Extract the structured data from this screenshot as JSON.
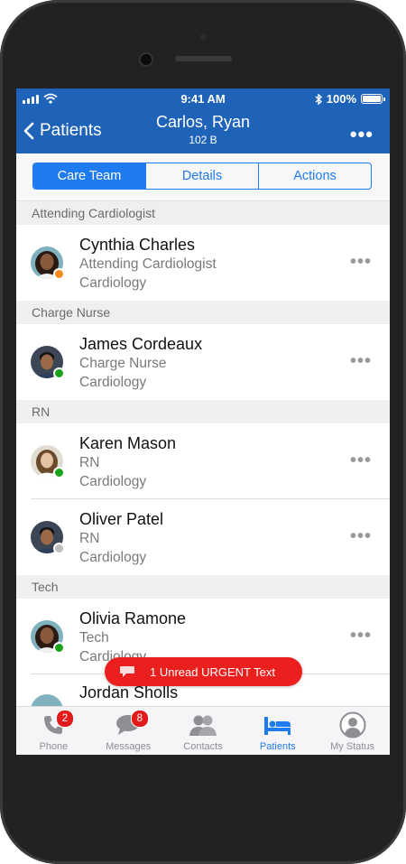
{
  "status_bar": {
    "time": "9:41 AM",
    "battery": "100%"
  },
  "nav": {
    "back_label": "Patients",
    "title": "Carlos, Ryan",
    "subtitle": "102 B",
    "more": "•••"
  },
  "tabs": [
    {
      "label": "Care Team",
      "active": true
    },
    {
      "label": "Details",
      "active": false
    },
    {
      "label": "Actions",
      "active": false
    }
  ],
  "sections": [
    {
      "header": "Attending Cardiologist",
      "members": [
        {
          "name": "Cynthia Charles",
          "role": "Attending Cardiologist",
          "dept": "Cardiology",
          "presence": "away"
        }
      ]
    },
    {
      "header": "Charge Nurse",
      "members": [
        {
          "name": "James Cordeaux",
          "role": "Charge Nurse",
          "dept": "Cardiology",
          "presence": "available"
        }
      ]
    },
    {
      "header": "RN",
      "members": [
        {
          "name": "Karen Mason",
          "role": "RN",
          "dept": "Cardiology",
          "presence": "available"
        },
        {
          "name": "Oliver Patel",
          "role": "RN",
          "dept": "Cardiology",
          "presence": "offline"
        }
      ]
    },
    {
      "header": "Tech",
      "members": [
        {
          "name": "Olivia Ramone",
          "role": "Tech",
          "dept": "Cardiology",
          "presence": "available"
        },
        {
          "name": "Jordan Sholls",
          "role": "",
          "dept": "",
          "presence": ""
        }
      ]
    }
  ],
  "row_more": "•••",
  "urgent_banner": "1 Unread URGENT Text",
  "tab_bar": [
    {
      "label": "Phone",
      "icon": "phone-icon",
      "badge": "2"
    },
    {
      "label": "Messages",
      "icon": "messages-icon",
      "badge": "8"
    },
    {
      "label": "Contacts",
      "icon": "contacts-icon",
      "badge": ""
    },
    {
      "label": "Patients",
      "icon": "patients-icon",
      "badge": "",
      "active": true
    },
    {
      "label": "My Status",
      "icon": "my-status-icon",
      "badge": ""
    }
  ],
  "colors": {
    "nav_blue": "#1f63b8",
    "accent_blue": "#1f7cf0",
    "urgent_red": "#ec1f1f",
    "available": "#1aa31a",
    "away": "#f58a1f",
    "offline": "#bdbdbd"
  }
}
